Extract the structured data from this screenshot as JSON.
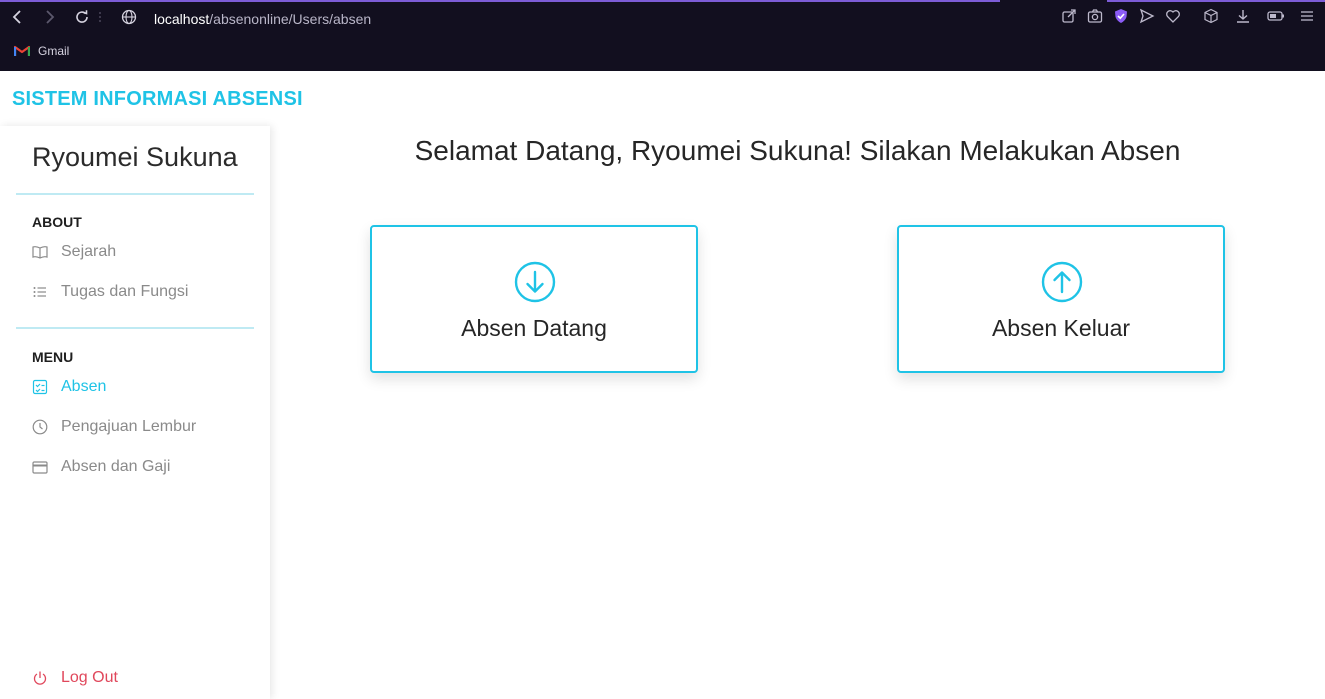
{
  "browser": {
    "url_host": "localhost",
    "url_path": "/absenonline/Users/absen",
    "bookmarks": [
      {
        "label": "Gmail",
        "icon": "gmail-icon"
      }
    ]
  },
  "app": {
    "brand": "SISTEM INFORMASI ABSENSI",
    "accent_color": "#1fc3e6"
  },
  "sidebar": {
    "user_name": "Ryoumei Sukuna",
    "sections": [
      {
        "title": "ABOUT",
        "items": [
          {
            "label": "Sejarah",
            "icon": "book-icon"
          },
          {
            "label": "Tugas dan Fungsi",
            "icon": "list-icon"
          }
        ]
      },
      {
        "title": "MENU",
        "items": [
          {
            "label": "Absen",
            "icon": "checklist-icon",
            "active": true
          },
          {
            "label": "Pengajuan Lembur",
            "icon": "clock-icon"
          },
          {
            "label": "Absen dan Gaji",
            "icon": "card-icon"
          }
        ]
      }
    ],
    "logout_label": "Log Out"
  },
  "main": {
    "welcome": "Selamat Datang, Ryoumei Sukuna! Silakan Melakukan Absen",
    "cards": [
      {
        "label": "Absen Datang",
        "icon": "arrow-down-circle-icon"
      },
      {
        "label": "Absen Keluar",
        "icon": "arrow-up-circle-icon"
      }
    ]
  }
}
